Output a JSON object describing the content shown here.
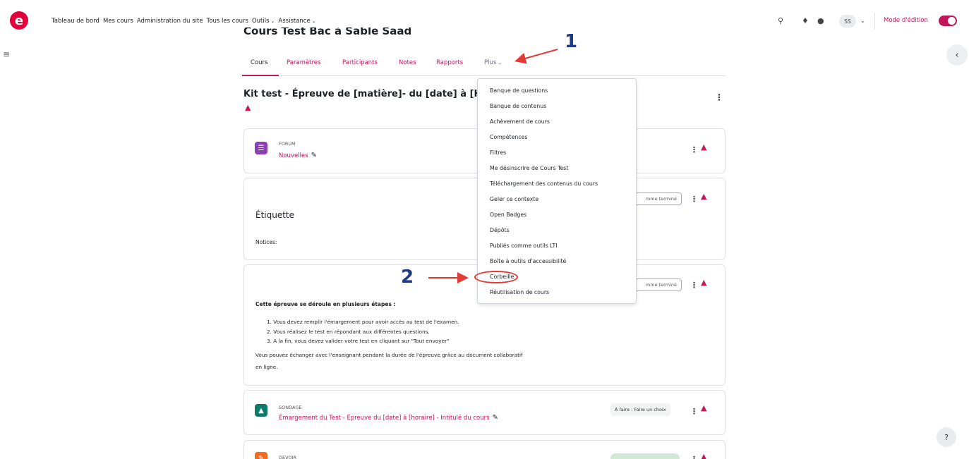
{
  "navbar": {
    "logo_letter": "e",
    "items": [
      {
        "label": "Tableau de bord",
        "dropdown": false
      },
      {
        "label": "Mes cours",
        "dropdown": false
      },
      {
        "label": "Administration du site",
        "dropdown": false
      },
      {
        "label": "Tous les cours",
        "dropdown": false
      },
      {
        "label": "Outils",
        "dropdown": true
      },
      {
        "label": "Assistance",
        "dropdown": true
      }
    ],
    "user_initials": "SS",
    "edit_mode_label": "Mode d'édition",
    "edit_mode_on": true
  },
  "course": {
    "title": "Cours Test Bac à Sable Saad",
    "tabs": [
      {
        "label": "Cours",
        "active": true
      },
      {
        "label": "Paramètres",
        "active": false
      },
      {
        "label": "Participants",
        "active": false
      },
      {
        "label": "Notes",
        "active": false
      },
      {
        "label": "Rapports",
        "active": false
      },
      {
        "label": "Plus",
        "active": false
      }
    ]
  },
  "section": {
    "title": "Kit test - Épreuve de [matière]- du [date] à [Hor"
  },
  "activities": {
    "forum": {
      "type": "FORUM",
      "name": "Nouvelles"
    },
    "label1": {
      "heading": "Étiquette",
      "text": "Notices:",
      "mark_done": "mme terminé"
    },
    "label2": {
      "mark_done": "mme terminé",
      "intro": "Cette épreuve se déroule en plusieurs étapes :",
      "steps": [
        "1. Vous devez remplir l'émargement pour avoir accès au test de l'examen.",
        "2. Vous réalisez le test en répondant aux différentes questions.",
        "3. A la fin, vous devez valider votre test en cliquant sur \"Tout envoyer\""
      ],
      "tail1": "Vous pouvez échanger avec l'enseignant pendant la durée de l'épreuve grâce au document collaboratif",
      "tail2": "en ligne."
    },
    "sondage": {
      "type": "SONDAGE",
      "name": "Émargement du Test - Épreuve du [date] à [horaire] - Intitulé du cours",
      "todo": "À faire : Faire un choix"
    },
    "devoir": {
      "type": "DEVOIR"
    }
  },
  "dropdown_menu": {
    "items": [
      "Banque de questions",
      "Banque de contenus",
      "Achèvement de cours",
      "Compétences",
      "Filtres",
      "Me désinscrire de Cours Test",
      "Téléchargement des contenus du cours",
      "Geler ce contexte",
      "Open Badges",
      "Dépôts",
      "Publiés comme outils LTI",
      "Boîte à outils d'accessibilité",
      "Corbeille",
      "Réutilisation de cours"
    ],
    "highlighted": "Corbeille"
  },
  "annotations": {
    "step1": "1",
    "step2": "2",
    "arrow_color": "#e53935",
    "number_color": "#1e3a8a"
  },
  "colors": {
    "brand": "#e2003b",
    "accent": "#c2185b",
    "forum_icon": "#8e3fb5",
    "sondage_icon": "#0f7a6b",
    "devoir_icon": "#f26b21"
  },
  "help_label": "?"
}
